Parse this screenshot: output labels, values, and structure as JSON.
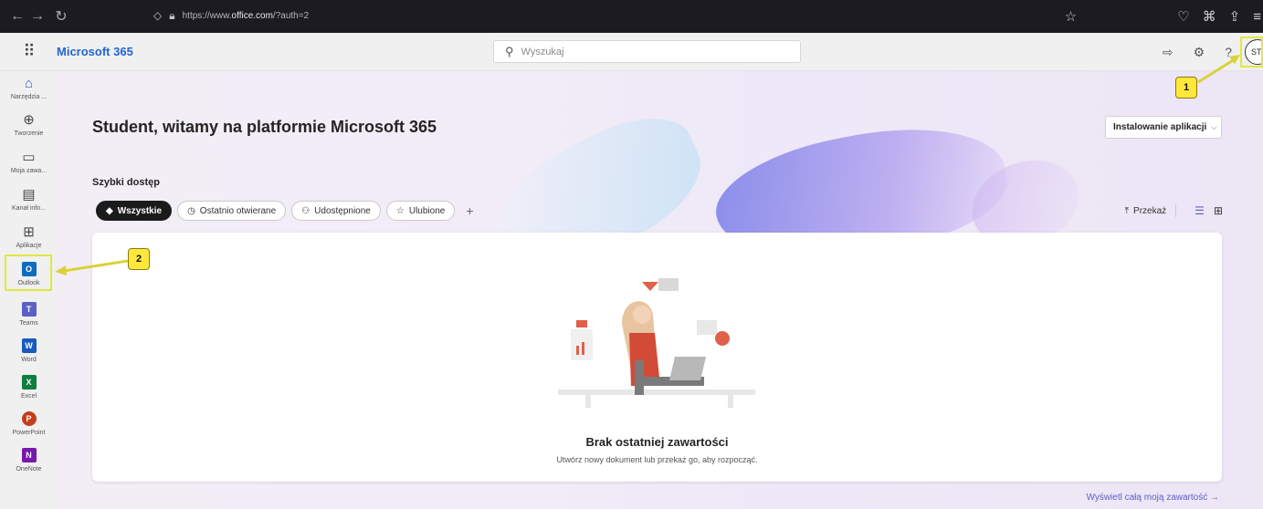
{
  "browser": {
    "url_prefix": "https://www.",
    "url_domain": "office.com",
    "url_rest": "/?auth=2"
  },
  "header": {
    "brand": "Microsoft 365",
    "search_placeholder": "Wyszukaj",
    "avatar_initials": "ST",
    "help": "?"
  },
  "rail": {
    "items": [
      {
        "label": "Narzędzia ...",
        "icon": "home-icon"
      },
      {
        "label": "Tworzenie",
        "icon": "plus-circle-icon"
      },
      {
        "label": "Moja zawa...",
        "icon": "folder-icon"
      },
      {
        "label": "Kanał info...",
        "icon": "feed-icon"
      },
      {
        "label": "Aplikacje",
        "icon": "apps-icon"
      },
      {
        "label": "Outlook",
        "icon": "outlook-icon",
        "letter": "O",
        "color": "#0f6cbd"
      },
      {
        "label": "Teams",
        "icon": "teams-icon",
        "letter": "T",
        "color": "#5b5fc7"
      },
      {
        "label": "Word",
        "icon": "word-icon",
        "letter": "W",
        "color": "#185abd"
      },
      {
        "label": "Excel",
        "icon": "excel-icon",
        "letter": "X",
        "color": "#107c41"
      },
      {
        "label": "PowerPoint",
        "icon": "powerpoint-icon",
        "letter": "P",
        "color": "#c43e1c"
      },
      {
        "label": "OneNote",
        "icon": "onenote-icon",
        "letter": "N",
        "color": "#7719aa"
      }
    ]
  },
  "main": {
    "welcome": "Student, witamy na platformie Microsoft 365",
    "install_label": "Instalowanie aplikacji",
    "quick_access": "Szybki dostęp",
    "filters": [
      "Wszystkie",
      "Ostatnio otwierane",
      "Udostępnione",
      "Ulubione"
    ],
    "upload_label": "Przekaż",
    "empty_title": "Brak ostatniej zawartości",
    "empty_sub": "Utwórz nowy dokument lub przekaż go, aby rozpocząć.",
    "see_all": "Wyświetl całą moją zawartość"
  },
  "callouts": {
    "one": "1",
    "two": "2"
  },
  "colors": {
    "brand": "#2564cf",
    "accent": "#5b5fc7",
    "highlight": "#ffe83a"
  }
}
